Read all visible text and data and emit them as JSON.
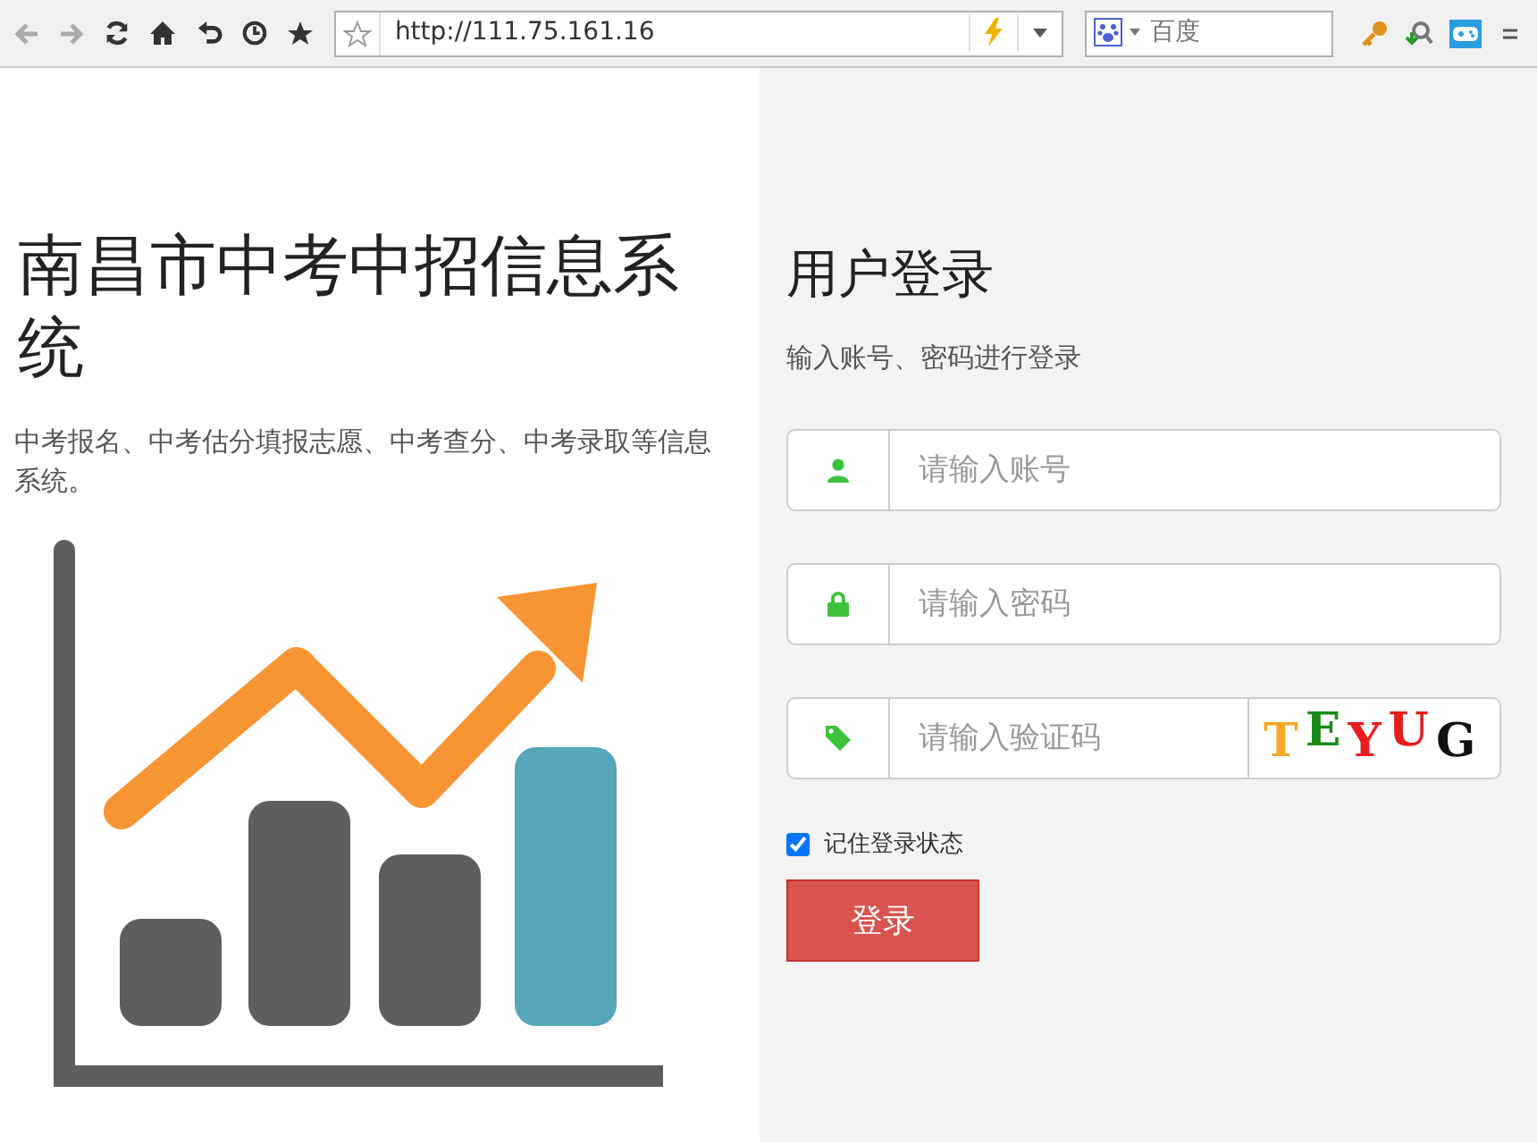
{
  "toolbar": {
    "address": "http://111.75.161.16",
    "search_placeholder": "百度"
  },
  "intro": {
    "title": "南昌市中考中招信息系统",
    "description": "中考报名、中考估分填报志愿、中考查分、中考录取等信息系统。"
  },
  "login": {
    "title": "用户登录",
    "subtitle": "输入账号、密码进行登录",
    "fields": [
      {
        "kind": "user",
        "placeholder": "请输入账号"
      },
      {
        "kind": "lock",
        "placeholder": "请输入密码"
      },
      {
        "kind": "captcha",
        "placeholder": "请输入验证码",
        "captcha_letters": [
          {
            "text": "T",
            "color": "#f5a623"
          },
          {
            "text": "E",
            "color": "#1a8a1a"
          },
          {
            "text": "Y",
            "color": "#e81c1c"
          },
          {
            "text": "U",
            "color": "#e81c1c"
          },
          {
            "text": "G",
            "color": "#111111"
          }
        ]
      }
    ],
    "remember": {
      "label": "记住登录状态",
      "checked": true
    },
    "submit": "登录"
  }
}
